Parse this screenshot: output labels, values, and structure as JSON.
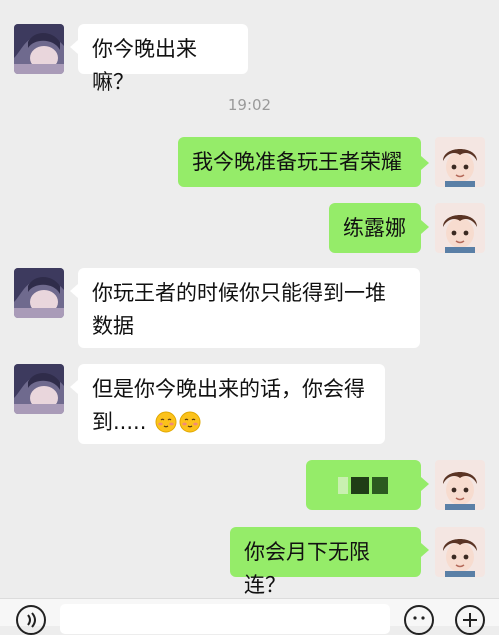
{
  "chat": {
    "timestamp": "19:02",
    "messages": [
      {
        "side": "left",
        "text": "你今晚出来嘛？"
      },
      {
        "side": "right",
        "text": "我今晚准备玩王者荣耀"
      },
      {
        "side": "right",
        "text": "练露娜"
      },
      {
        "side": "left",
        "text": "你玩王者的时候你只能得到一堆数据"
      },
      {
        "side": "left",
        "text": "但是你今晚出来的话，你会得到....."
      },
      {
        "side": "right",
        "text": ""
      },
      {
        "side": "right",
        "text": "你会月下无限连？"
      }
    ]
  },
  "colors": {
    "background": "#ededed",
    "left_bubble": "#ffffff",
    "right_bubble": "#95ec69",
    "timestamp": "#9a9a9a"
  },
  "icons": {
    "voice": "voice-icon",
    "emoji": "emoji-icon",
    "plus": "plus-icon",
    "blush_emoji": "blushing-face-emoji"
  }
}
